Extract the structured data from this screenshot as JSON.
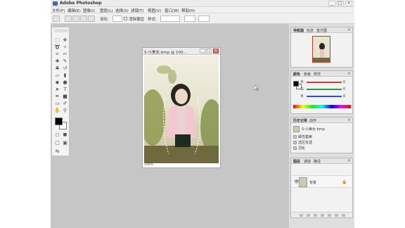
{
  "window": {
    "title": "Adobe Photoshop",
    "controls": {
      "minimize": "_",
      "maximize": "□",
      "close": "×"
    }
  },
  "menu": [
    "文件(F)",
    "编辑(E)",
    "图像(I)",
    "图层(L)",
    "选择(S)",
    "滤镜(T)",
    "视图(V)",
    "窗口(W)",
    "帮助(H)"
  ],
  "options_bar": {
    "feather_label": "羽化:",
    "antialias_label": "消除锯齿",
    "style_label": "样式:"
  },
  "document": {
    "title": "S-小美女.bmp @ 100...",
    "status": "100%",
    "controls": {
      "minimize": "_",
      "maximize": "□",
      "close": "×"
    }
  },
  "panels": {
    "navigator": {
      "tabs": [
        "导航器",
        "信息",
        "直方图"
      ],
      "close": "×"
    },
    "color": {
      "tabs": [
        "颜色",
        "色板",
        "样式"
      ],
      "close": "×",
      "sliders": [
        {
          "label": "R",
          "value": "0",
          "color": "#d23a3a"
        },
        {
          "label": "G",
          "value": "0",
          "color": "#2f9a3a"
        },
        {
          "label": "B",
          "value": "0",
          "color": "#2f4fd0"
        }
      ]
    },
    "history": {
      "tabs": [
        "历史记录",
        "动作"
      ],
      "close": "×",
      "doc_label": "S-小美女.bmp",
      "items": [
        "磁性套索",
        "选区反选",
        "羽化"
      ]
    },
    "layers": {
      "tabs": [
        "图层",
        "通道",
        "路径"
      ],
      "close": "×",
      "layer_name": "背景",
      "eye": "👁",
      "lock": "🔒"
    }
  }
}
